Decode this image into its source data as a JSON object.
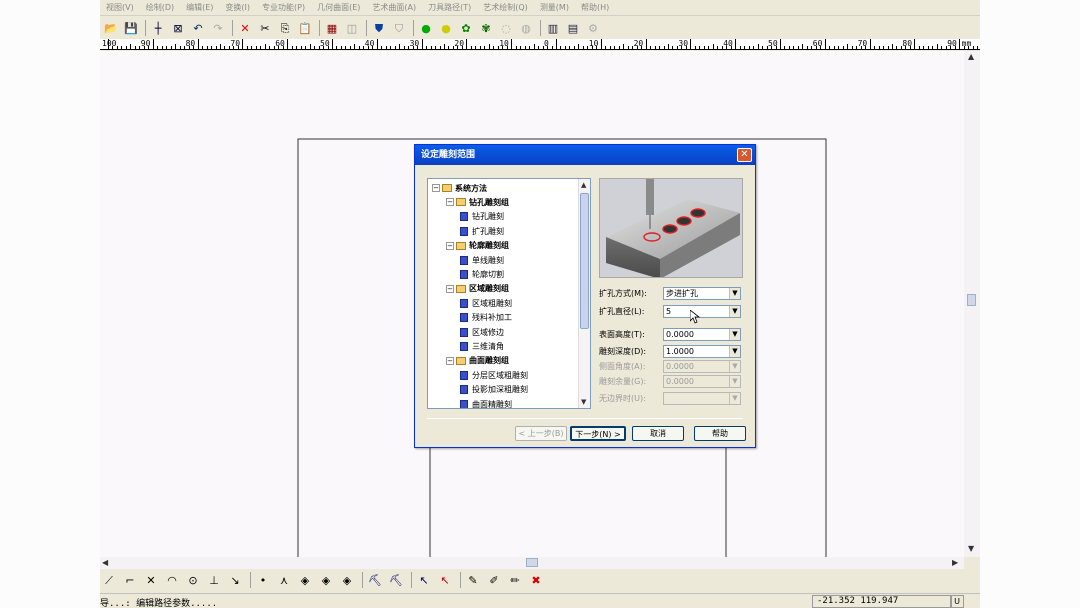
{
  "menubar": {
    "items": [
      "视图(V)",
      "绘制(D)",
      "编辑(E)",
      "变换(I)",
      "专业功能(P)",
      "几何曲面(E)",
      "艺术曲面(A)",
      "刀具路径(T)",
      "艺术绘制(Q)",
      "测量(M)",
      "帮助(H)"
    ]
  },
  "ruler": {
    "labels": [
      "100",
      "90",
      "80",
      "70",
      "60",
      "50",
      "40",
      "30",
      "20",
      "10",
      "0",
      "10",
      "20",
      "30",
      "40",
      "50",
      "60",
      "70",
      "80",
      "90 mm"
    ]
  },
  "dialog": {
    "title": "设定雕刻范围",
    "close_label": "✕",
    "tree": [
      {
        "label": "系统方法",
        "level": 0,
        "kind": "folder",
        "bold": true
      },
      {
        "label": "钻孔雕刻组",
        "level": 1,
        "kind": "folder",
        "bold": true
      },
      {
        "label": "钻孔雕刻",
        "level": 2,
        "kind": "leaf"
      },
      {
        "label": "扩孔雕刻",
        "level": 2,
        "kind": "leaf"
      },
      {
        "label": "轮廓雕刻组",
        "level": 1,
        "kind": "folder",
        "bold": true
      },
      {
        "label": "单线雕刻",
        "level": 2,
        "kind": "leaf"
      },
      {
        "label": "轮廓切割",
        "level": 2,
        "kind": "leaf"
      },
      {
        "label": "区域雕刻组",
        "level": 1,
        "kind": "folder",
        "bold": true
      },
      {
        "label": "区域粗雕刻",
        "level": 2,
        "kind": "leaf"
      },
      {
        "label": "残料补加工",
        "level": 2,
        "kind": "leaf"
      },
      {
        "label": "区域修边",
        "level": 2,
        "kind": "leaf"
      },
      {
        "label": "三维清角",
        "level": 2,
        "kind": "leaf"
      },
      {
        "label": "曲面雕刻组",
        "level": 1,
        "kind": "folder",
        "bold": true
      },
      {
        "label": "分层区域粗雕刻",
        "level": 2,
        "kind": "leaf"
      },
      {
        "label": "投影加深粗雕刻",
        "level": 2,
        "kind": "leaf"
      },
      {
        "label": "曲面精雕刻",
        "level": 2,
        "kind": "leaf"
      }
    ],
    "fields": {
      "ream_method": {
        "label": "扩孔方式(M):",
        "value": "步进扩孔"
      },
      "ream_diameter": {
        "label": "扩孔直径(L):",
        "value": "5"
      },
      "surface_height": {
        "label": "表面高度(T):",
        "value": "0.0000"
      },
      "carve_depth": {
        "label": "雕刻深度(D):",
        "value": "1.0000"
      },
      "side_angle": {
        "label": "侧面角度(A):",
        "value": "0.0000"
      },
      "carve_allowance": {
        "label": "雕刻余量(G):",
        "value": "0.0000"
      },
      "boundless_when": {
        "label": "无边界时(U):",
        "value": ""
      }
    },
    "buttons": {
      "prev": "< 上一步(B)",
      "next": "下一步(N) >",
      "cancel": "取消",
      "help": "帮助"
    }
  },
  "statusbar": {
    "message": "导...: 编辑路径参数.....",
    "coords": "-21.352 119.947",
    "mode": "U"
  },
  "colors": {
    "title_bar": "#0b4fd8",
    "close_button": "#d9572c",
    "folder": "#f0d070",
    "leaf": "#3b4fc8",
    "hole_ring": "#e02020"
  }
}
